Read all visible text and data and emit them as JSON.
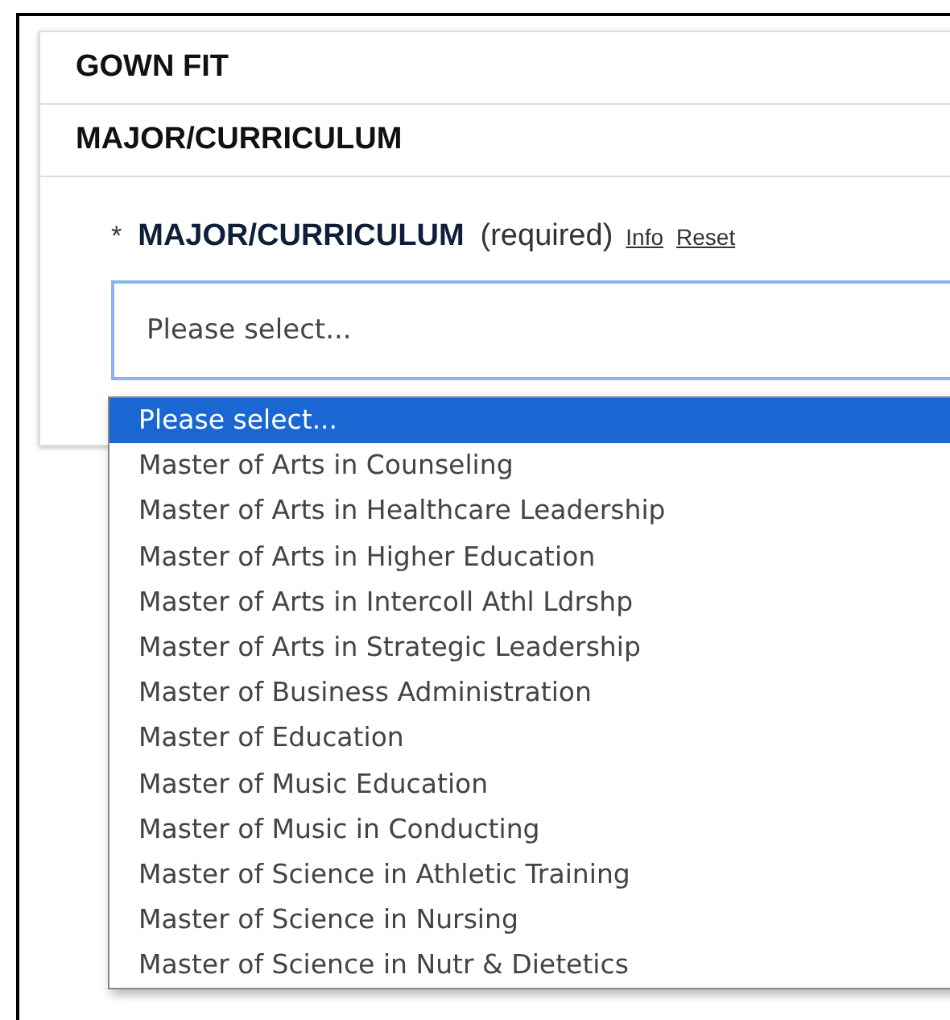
{
  "sections": [
    {
      "title": "GOWN FIT"
    },
    {
      "title": "MAJOR/CURRICULUM"
    }
  ],
  "field": {
    "required_mark": "*",
    "label": "MAJOR/CURRICULUM",
    "note": "(required)",
    "links": [
      "Info",
      "Reset"
    ],
    "value": "Please select...",
    "focused": true
  },
  "dropdown": {
    "options": [
      {
        "label": "Please select...",
        "selected": true
      },
      {
        "label": "Master of Arts in Counseling",
        "selected": false
      },
      {
        "label": "Master of Arts in Healthcare Leadership",
        "selected": false
      },
      {
        "label": "Master of Arts in Higher Education",
        "selected": false
      },
      {
        "label": "Master of Arts in Intercoll Athl Ldrshp",
        "selected": false
      },
      {
        "label": "Master of Arts in Strategic Leadership",
        "selected": false
      },
      {
        "label": "Master of Business Administration",
        "selected": false
      },
      {
        "label": "Master of Education",
        "selected": false
      },
      {
        "label": "Master of Music Education",
        "selected": false
      },
      {
        "label": "Master of Music in Conducting",
        "selected": false
      },
      {
        "label": "Master of Science in Athletic Training",
        "selected": false
      },
      {
        "label": "Master of Science in Nursing",
        "selected": false
      },
      {
        "label": "Master of Science in Nutr & Dietetics",
        "selected": false
      }
    ]
  }
}
